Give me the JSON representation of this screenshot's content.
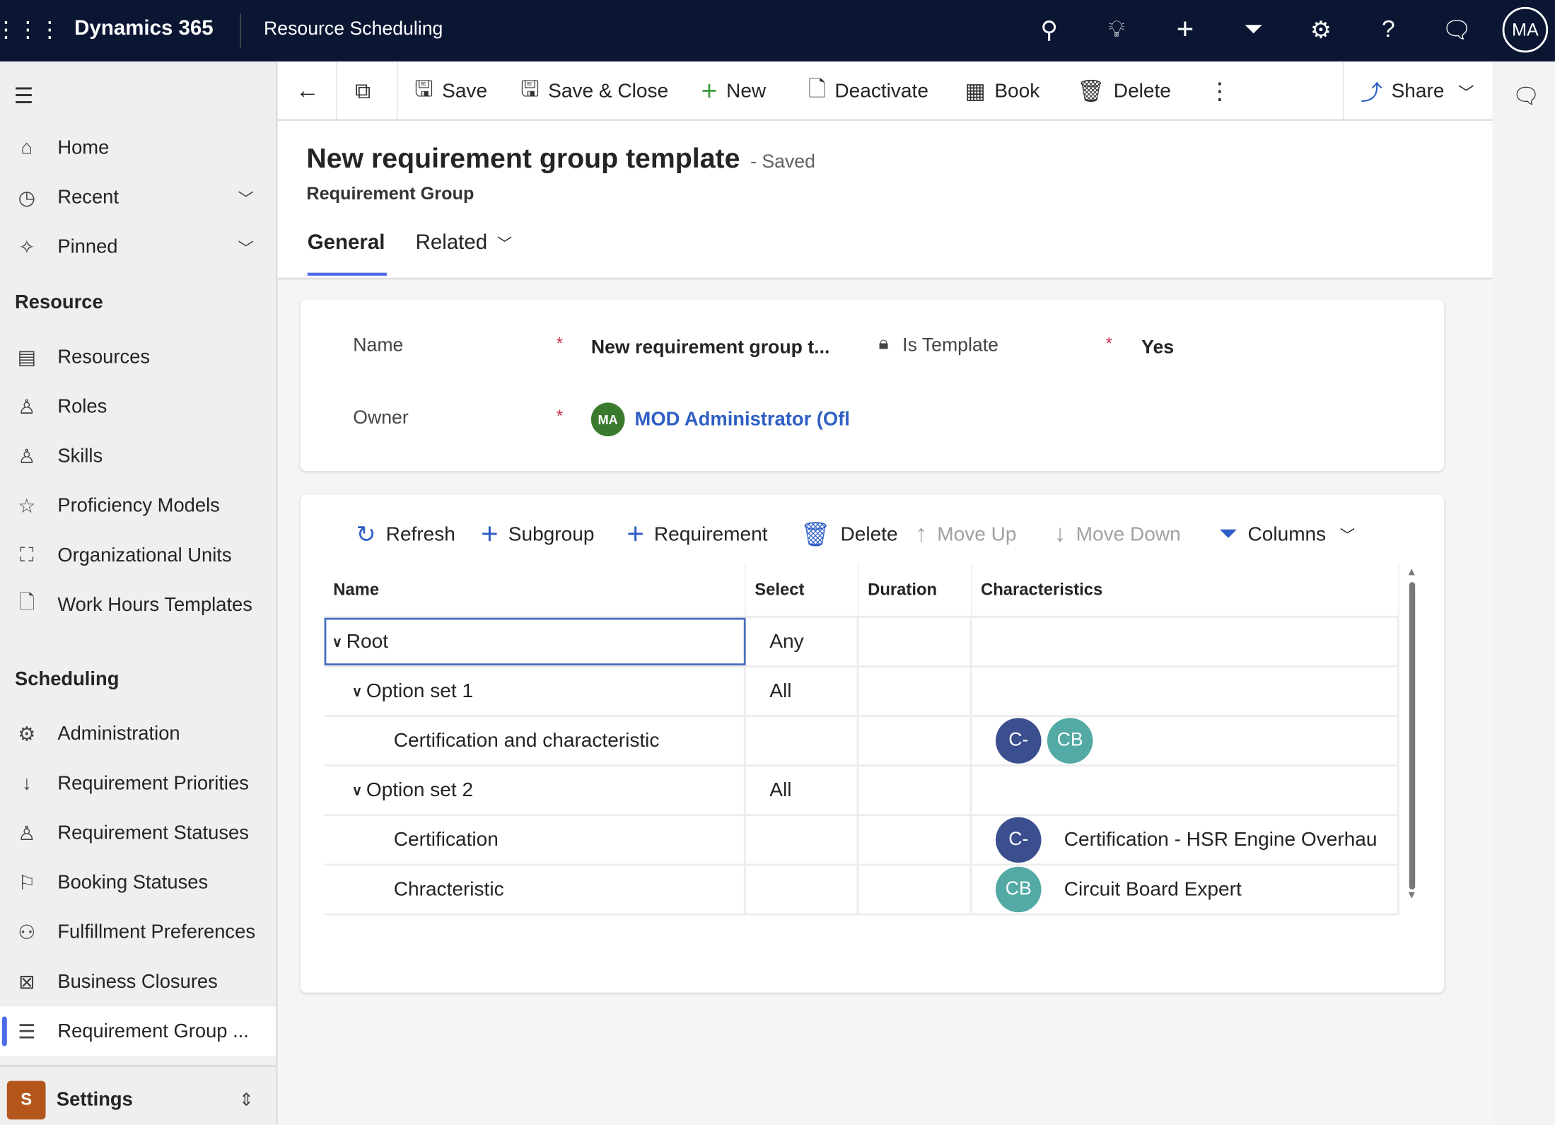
{
  "topbar": {
    "brand": "Dynamics 365",
    "app": "Resource Scheduling",
    "avatar": "MA"
  },
  "sidebar": {
    "home": "Home",
    "recent": "Recent",
    "pinned": "Pinned",
    "sections": [
      {
        "title": "Resource",
        "items": [
          "Resources",
          "Roles",
          "Skills",
          "Proficiency Models",
          "Organizational Units",
          "Work Hours Templates"
        ]
      },
      {
        "title": "Scheduling",
        "items": [
          "Administration",
          "Requirement Priorities",
          "Requirement Statuses",
          "Booking Statuses",
          "Fulfillment Preferences",
          "Business Closures",
          "Requirement Group ..."
        ]
      }
    ],
    "area": {
      "badge": "S",
      "label": "Settings"
    }
  },
  "commands": {
    "save": "Save",
    "save_close": "Save & Close",
    "new": "New",
    "deactivate": "Deactivate",
    "book": "Book",
    "delete": "Delete",
    "share": "Share"
  },
  "header": {
    "title": "New requirement group template",
    "status": "- Saved",
    "entity": "Requirement Group",
    "tabs": [
      "General",
      "Related"
    ]
  },
  "form": {
    "name_label": "Name",
    "name_value": "New requirement group t...",
    "is_template_label": "Is Template",
    "is_template_value": "Yes",
    "owner_label": "Owner",
    "owner_initials": "MA",
    "owner_value": "MOD Administrator (Ofl"
  },
  "grid_toolbar": {
    "refresh": "Refresh",
    "subgroup": "Subgroup",
    "requirement": "Requirement",
    "delete": "Delete",
    "move_up": "Move Up",
    "move_down": "Move Down",
    "columns": "Columns"
  },
  "grid": {
    "columns": [
      "Name",
      "Select",
      "Duration",
      "Characteristics"
    ],
    "rows": [
      {
        "name": "Root",
        "select": "Any",
        "level": 0,
        "expand": true
      },
      {
        "name": "Option set 1",
        "select": "All",
        "level": 1,
        "expand": true
      },
      {
        "name": "Certification and characteristic",
        "select": "",
        "level": 2,
        "chars": [
          "C-",
          "CB"
        ]
      },
      {
        "name": "Option set 2",
        "select": "All",
        "level": 1,
        "expand": true
      },
      {
        "name": "Certification",
        "select": "",
        "level": 2,
        "chars": [
          "C-"
        ],
        "char_label": "Certification - HSR Engine Overhau"
      },
      {
        "name": "Chracteristic",
        "select": "",
        "level": 2,
        "chars": [
          "CB"
        ],
        "char_label": "Circuit Board Expert"
      }
    ]
  },
  "colors": {
    "topbar": "#0b1633",
    "accent": "#2f5fc4",
    "cert": "#3b4f8f",
    "skill": "#53a9a3",
    "settings": "#b4561c"
  }
}
